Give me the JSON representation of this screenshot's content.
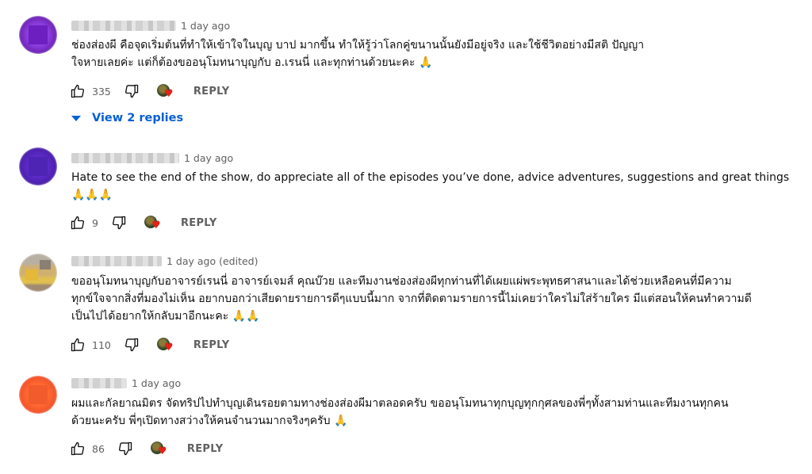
{
  "comments": [
    {
      "time": "1 day ago",
      "lines": [
        "ช่องส่องผี คือจุดเริ่มต้นที่ทำให้เข้าใจในบุญ บาป มากขึ้น ทำให้รู้ว่าโลกคู่ขนานนั้นยังมีอยู่จริง และใช้ชีวิตอย่างมีสติ ปัญญา",
        "ใจหายเลยค่ะ แต่ก็ต้องขออนุโมทนาบุญกับ อ.เรนนี่ และทุกท่านด้วยนะคะ 🙏"
      ],
      "likes": "335",
      "reply_label": "REPLY",
      "avatar_color": "#7b2fc0",
      "view_replies": "View 2 replies"
    },
    {
      "time": "1 day ago",
      "lines": [
        "Hate to see the end of the show, do appreciate all of the episodes you’ve done, advice adventures, suggestions and great things",
        "🙏🙏🙏"
      ],
      "likes": "9",
      "reply_label": "REPLY",
      "avatar_color": "#5a2fb8"
    },
    {
      "time": "1 day ago (edited)",
      "lines": [
        "ขออนุโมทนาบุญกับอาจารย์เรนนี่ อาจารย์เจมส์ คุณบ๊วย และทีมงานช่องส่องผีทุกท่านที่ได้เผยแผ่พระพุทธศาสนาและได้ช่วยเหลือคนที่มีความ",
        "ทุกข์ใจจากสิ่งที่มองไม่เห็น อยากบอกว่าเสียดายรายการดีๆแบบนี้มาก จากที่ติดตามรายการนี้ไม่เคยว่าใครไม่ใส่ร้ายใคร มีแต่สอนให้คนทำความดี",
        "เป็นไปได้อยากให้กลับมาอีกนะคะ 🙏🙏"
      ],
      "likes": "110",
      "reply_label": "REPLY",
      "avatar_color": "#c8a860"
    },
    {
      "time": "1 day ago",
      "lines": [
        "ผมและกัลยาณมิตร จัดทริปไปทำบุญเดินรอยตามทางช่องส่องผีมาตลอดครับ  ขออนุโมทนาทุกบุญทุกกุศลของพี่ๆทั้งสามท่านและทีมงานทุกคน",
        "ด้วยนะครับ  พี่ๆเปิดทางสว่างให้คนจำนวนมากจริงๆครับ 🙏"
      ],
      "likes": "86",
      "reply_label": "REPLY",
      "avatar_color": "#f06a3a"
    }
  ],
  "icons": {
    "like": "thumbs-up-icon",
    "dislike": "thumbs-down-icon",
    "creator_heart": "creator-heart-icon"
  }
}
